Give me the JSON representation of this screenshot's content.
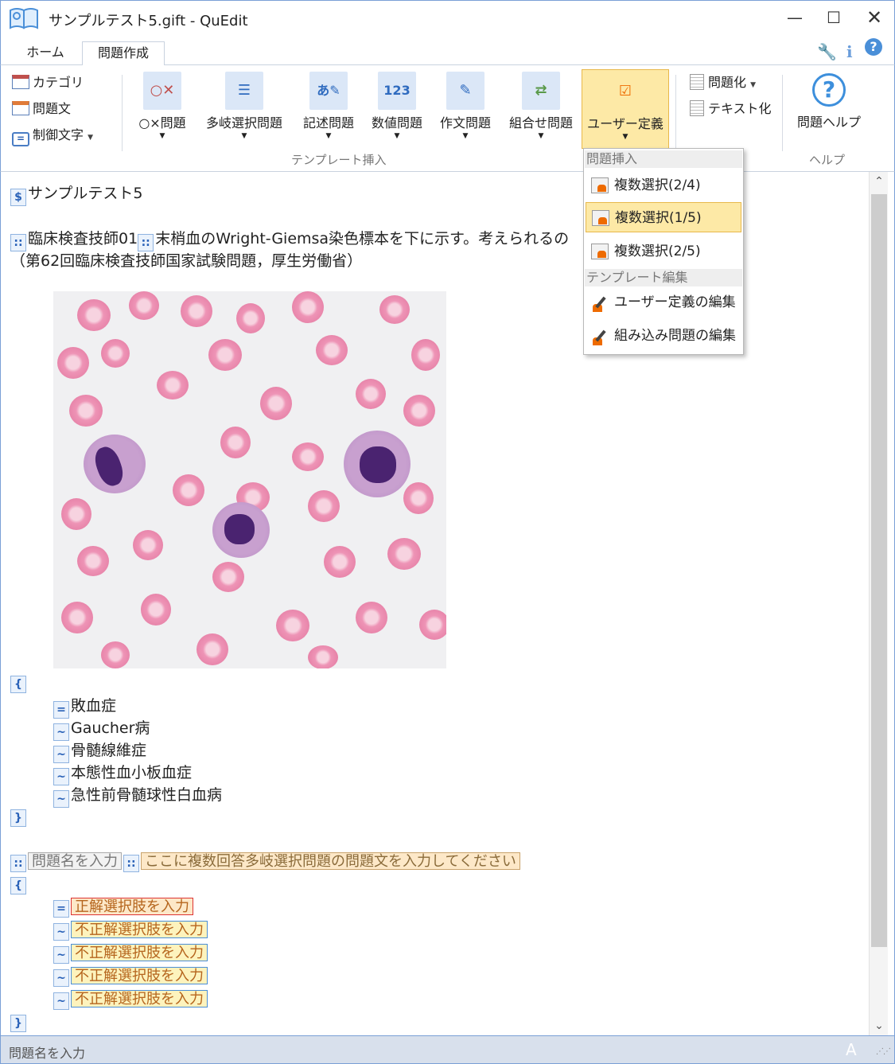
{
  "window": {
    "title": "サンプルテスト5.gift - QuEdit"
  },
  "tabs": {
    "home": "ホーム",
    "create": "問題作成"
  },
  "ribbon": {
    "small_buttons": {
      "category": "カテゴリ",
      "question_text": "問題文",
      "control_char": "制御文字"
    },
    "big_buttons": {
      "truefalse": "○×問題",
      "multi_choice": "多岐選択問題",
      "essay_short": "記述問題",
      "numeric": "数値問題",
      "composition": "作文問題",
      "matching": "組合せ問題",
      "user_defined": "ユーザー定義"
    },
    "group_template": "テンプレート挿入",
    "convert_question": "問題化",
    "convert_text": "テキスト化",
    "help_button": "問題ヘルプ",
    "group_help": "ヘルプ"
  },
  "dropdown": {
    "header_insert": "問題挿入",
    "items": [
      "複数選択(2/4)",
      "複数選択(1/5)",
      "複数選択(2/5)"
    ],
    "header_edit": "テンプレート編集",
    "edit_items": [
      "ユーザー定義の編集",
      "組み込み問題の編集"
    ]
  },
  "editor": {
    "marker_dollar": "$",
    "marker_colon": "::",
    "marker_eq": "=",
    "marker_tilde": "~",
    "marker_open": "{",
    "marker_close": "}",
    "title": "サンプルテスト5",
    "q1_name": "臨床検査技師01",
    "q1_text": "末梢血のWright-Giemsa染色標本を下に示す。考えられるの",
    "q1_source": "（第62回臨床検査技師国家試験問題，厚生労働省）",
    "q1_answers": {
      "correct": "敗血症",
      "wrong": [
        "Gaucher病",
        "骨髄線維症",
        "本態性血小板血症",
        "急性前骨髄球性白血病"
      ]
    },
    "q2_name_placeholder": "問題名を入力",
    "q2_text_placeholder": "ここに複数回答多岐選択問題の問題文を入力してください",
    "q2_correct_placeholder": "正解選択肢を入力",
    "q2_wrong_placeholder": [
      "不正解選択肢を入力",
      "不正解選択肢を入力",
      "不正解選択肢を入力",
      "不正解選択肢を入力"
    ]
  },
  "status": {
    "text": "問題名を入力",
    "mode": "A"
  }
}
